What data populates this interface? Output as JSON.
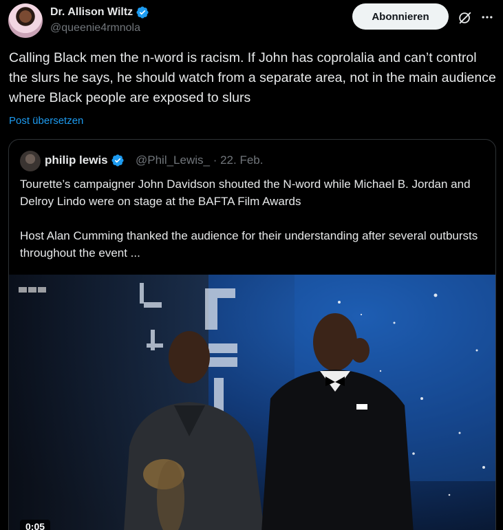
{
  "author": {
    "name": "Dr. Allison Wiltz",
    "handle": "@queenie4rmnola",
    "verified": true,
    "avatar": "avatar"
  },
  "actions": {
    "subscribe_label": "Abonnieren",
    "grok_icon": "grok-icon",
    "more_icon": "more-icon"
  },
  "tweet": {
    "text": "Calling Black men the n-word is racism. If John has coprolalia and can’t control the slurs he says, he should watch from a separate area, not in the main audience where Black people are exposed to slurs",
    "translate_label": "Post übersetzen"
  },
  "quote": {
    "name": "philip lewis",
    "handle": "@Phil_Lewis_",
    "date": "· 22. Feb.",
    "verified": true,
    "paragraphs": [
      "Tourette’s campaigner John Davidson shouted the N-word while Michael B. Jordan and Delroy Lindo were on stage at the BAFTA Film Awards",
      "Host Alan Cumming thanked the audience for their understanding after several outbursts throughout the event ..."
    ],
    "media": {
      "duration": "0:05",
      "backdrop_text": "SIAL V"
    }
  },
  "colors": {
    "background": "#000000",
    "text": "#e7e9ea",
    "secondary": "#71767b",
    "link": "#1d9bf0",
    "verified": "#1d9bf0",
    "button_bg": "#eff3f4",
    "border": "#2f3336"
  }
}
